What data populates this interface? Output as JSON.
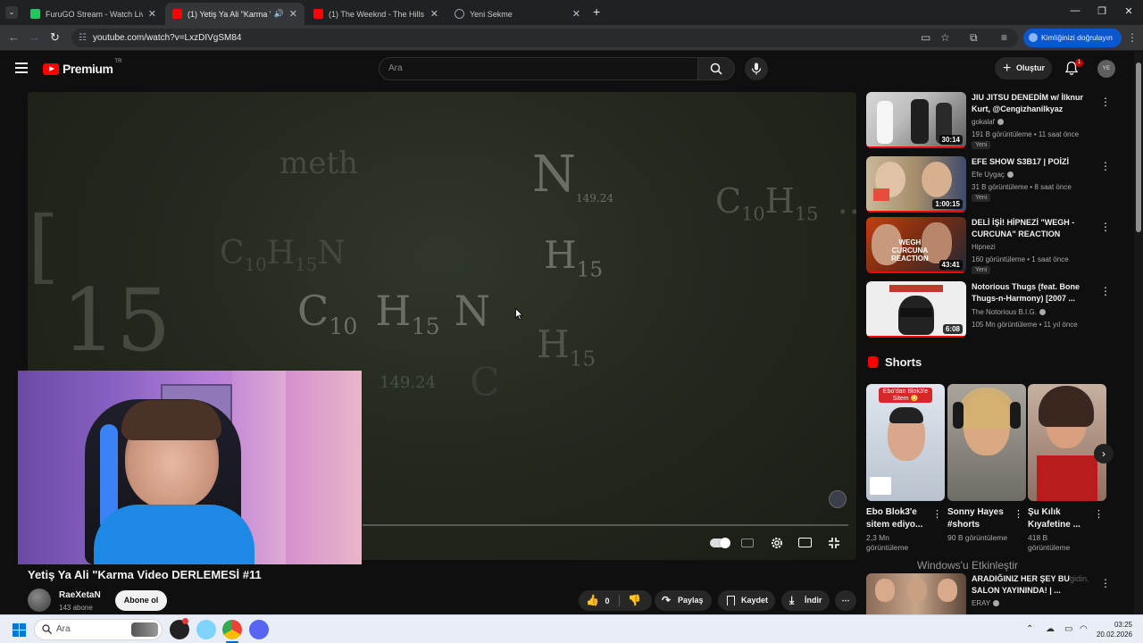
{
  "browser": {
    "tabs": [
      {
        "title": "FuruGO Stream - Watch Live on",
        "favicon_color": "#22c55e"
      },
      {
        "title": "(1) Yetiş Ya Ali \"Karma Video",
        "favicon_color": "#ff0000"
      },
      {
        "title": "(1) The Weeknd - The Hills - Yo",
        "favicon_color": "#ff0000"
      },
      {
        "title": "Yeni Sekme",
        "favicon_color": "#9aa0a6"
      }
    ],
    "url": "youtube.com/watch?v=LxzDIVgSM84",
    "identity_button": "Kimliğinizi doğrulayın"
  },
  "youtube": {
    "logo_text": "Premium",
    "region": "TR",
    "search_placeholder": "Ara",
    "create_label": "Oluştur",
    "notif_count": "1",
    "avatar_initials": "YE",
    "accent": "#ff0000"
  },
  "video": {
    "title": "Yetiş Ya Ali \"Karma Video DERLEMESİ #11",
    "channel": "RaeXetaN",
    "subscribers": "143 abone",
    "subscribe_label": "Abone ol",
    "likes": "0",
    "share_label": "Paylaş",
    "save_label": "Kaydet",
    "download_label": "İndir",
    "screen_text": {
      "meth": "meth",
      "n1": "N",
      "n1sub": "149.24",
      "c10": "C",
      "c10sub": "10",
      "h15": "H",
      "h15sub": "15",
      "small1": "149.24",
      "big15": "15",
      "n2": "N",
      "n3": "N",
      "c": "C"
    }
  },
  "sidebar": {
    "recommendations": [
      {
        "title": "JIU JITSU DENEDİM w/ İlknur Kurt, @Cengizhanilkyaz",
        "channel": "gokalaf",
        "verified": true,
        "meta": "191 B görüntüleme • 11 saat önce",
        "badge": "Yeni",
        "duration": "30:14",
        "thumb_colors": [
          "#d8d8d8",
          "#5a5a5a"
        ]
      },
      {
        "title": "EFE SHOW S3B17 | POİZİ",
        "channel": "Efe Uygaç",
        "verified": true,
        "meta": "31 B görüntüleme • 8 saat önce",
        "badge": "Yeni",
        "duration": "1:00:15",
        "thumb_colors": [
          "#c9b89a",
          "#3d4a6b"
        ]
      },
      {
        "title": "DELİ İŞİ! HİPNEZİ \"WEGH - CURCUNA\" REACTION",
        "channel": "Hipnezi",
        "verified": false,
        "meta": "160 görüntüleme • 1 saat önce",
        "badge": "Yeni",
        "duration": "43:41",
        "thumb_colors": [
          "#c2410c",
          "#1f2937"
        ]
      },
      {
        "title": "Notorious Thugs (feat. Bone Thugs-n-Harmony) [2007 ...",
        "channel": "The Notorious B.I.G.",
        "verified": true,
        "meta": "105 Mn görüntüleme • 11 yıl önce",
        "badge": "",
        "duration": "6:08",
        "thumb_colors": [
          "#eeeeee",
          "#222222"
        ]
      }
    ],
    "shorts_header": "Shorts",
    "shorts": [
      {
        "title": "Ebo Blok3'e sitem ediyo...",
        "views": "2,3 Mn görüntüleme",
        "overlay": "Ebo'dan Blok3'e Sitem 😳"
      },
      {
        "title": "Sonny Hayes #shorts",
        "views": "90 B görüntüleme",
        "overlay": ""
      },
      {
        "title": "Şu Kılık Kıyafetine ...",
        "views": "418 B görüntüleme",
        "overlay": ""
      }
    ],
    "last_rec": {
      "title": "ARADIĞINIZ HER ŞEY BU SALON YAYININDA! | ...",
      "channel": "ERAY"
    }
  },
  "watermark": {
    "line1": "Windows'u Etkinleştir",
    "line2": "gidin."
  },
  "taskbar": {
    "search_placeholder": "Ara",
    "time": "03:25",
    "date": "20.02.2026"
  }
}
